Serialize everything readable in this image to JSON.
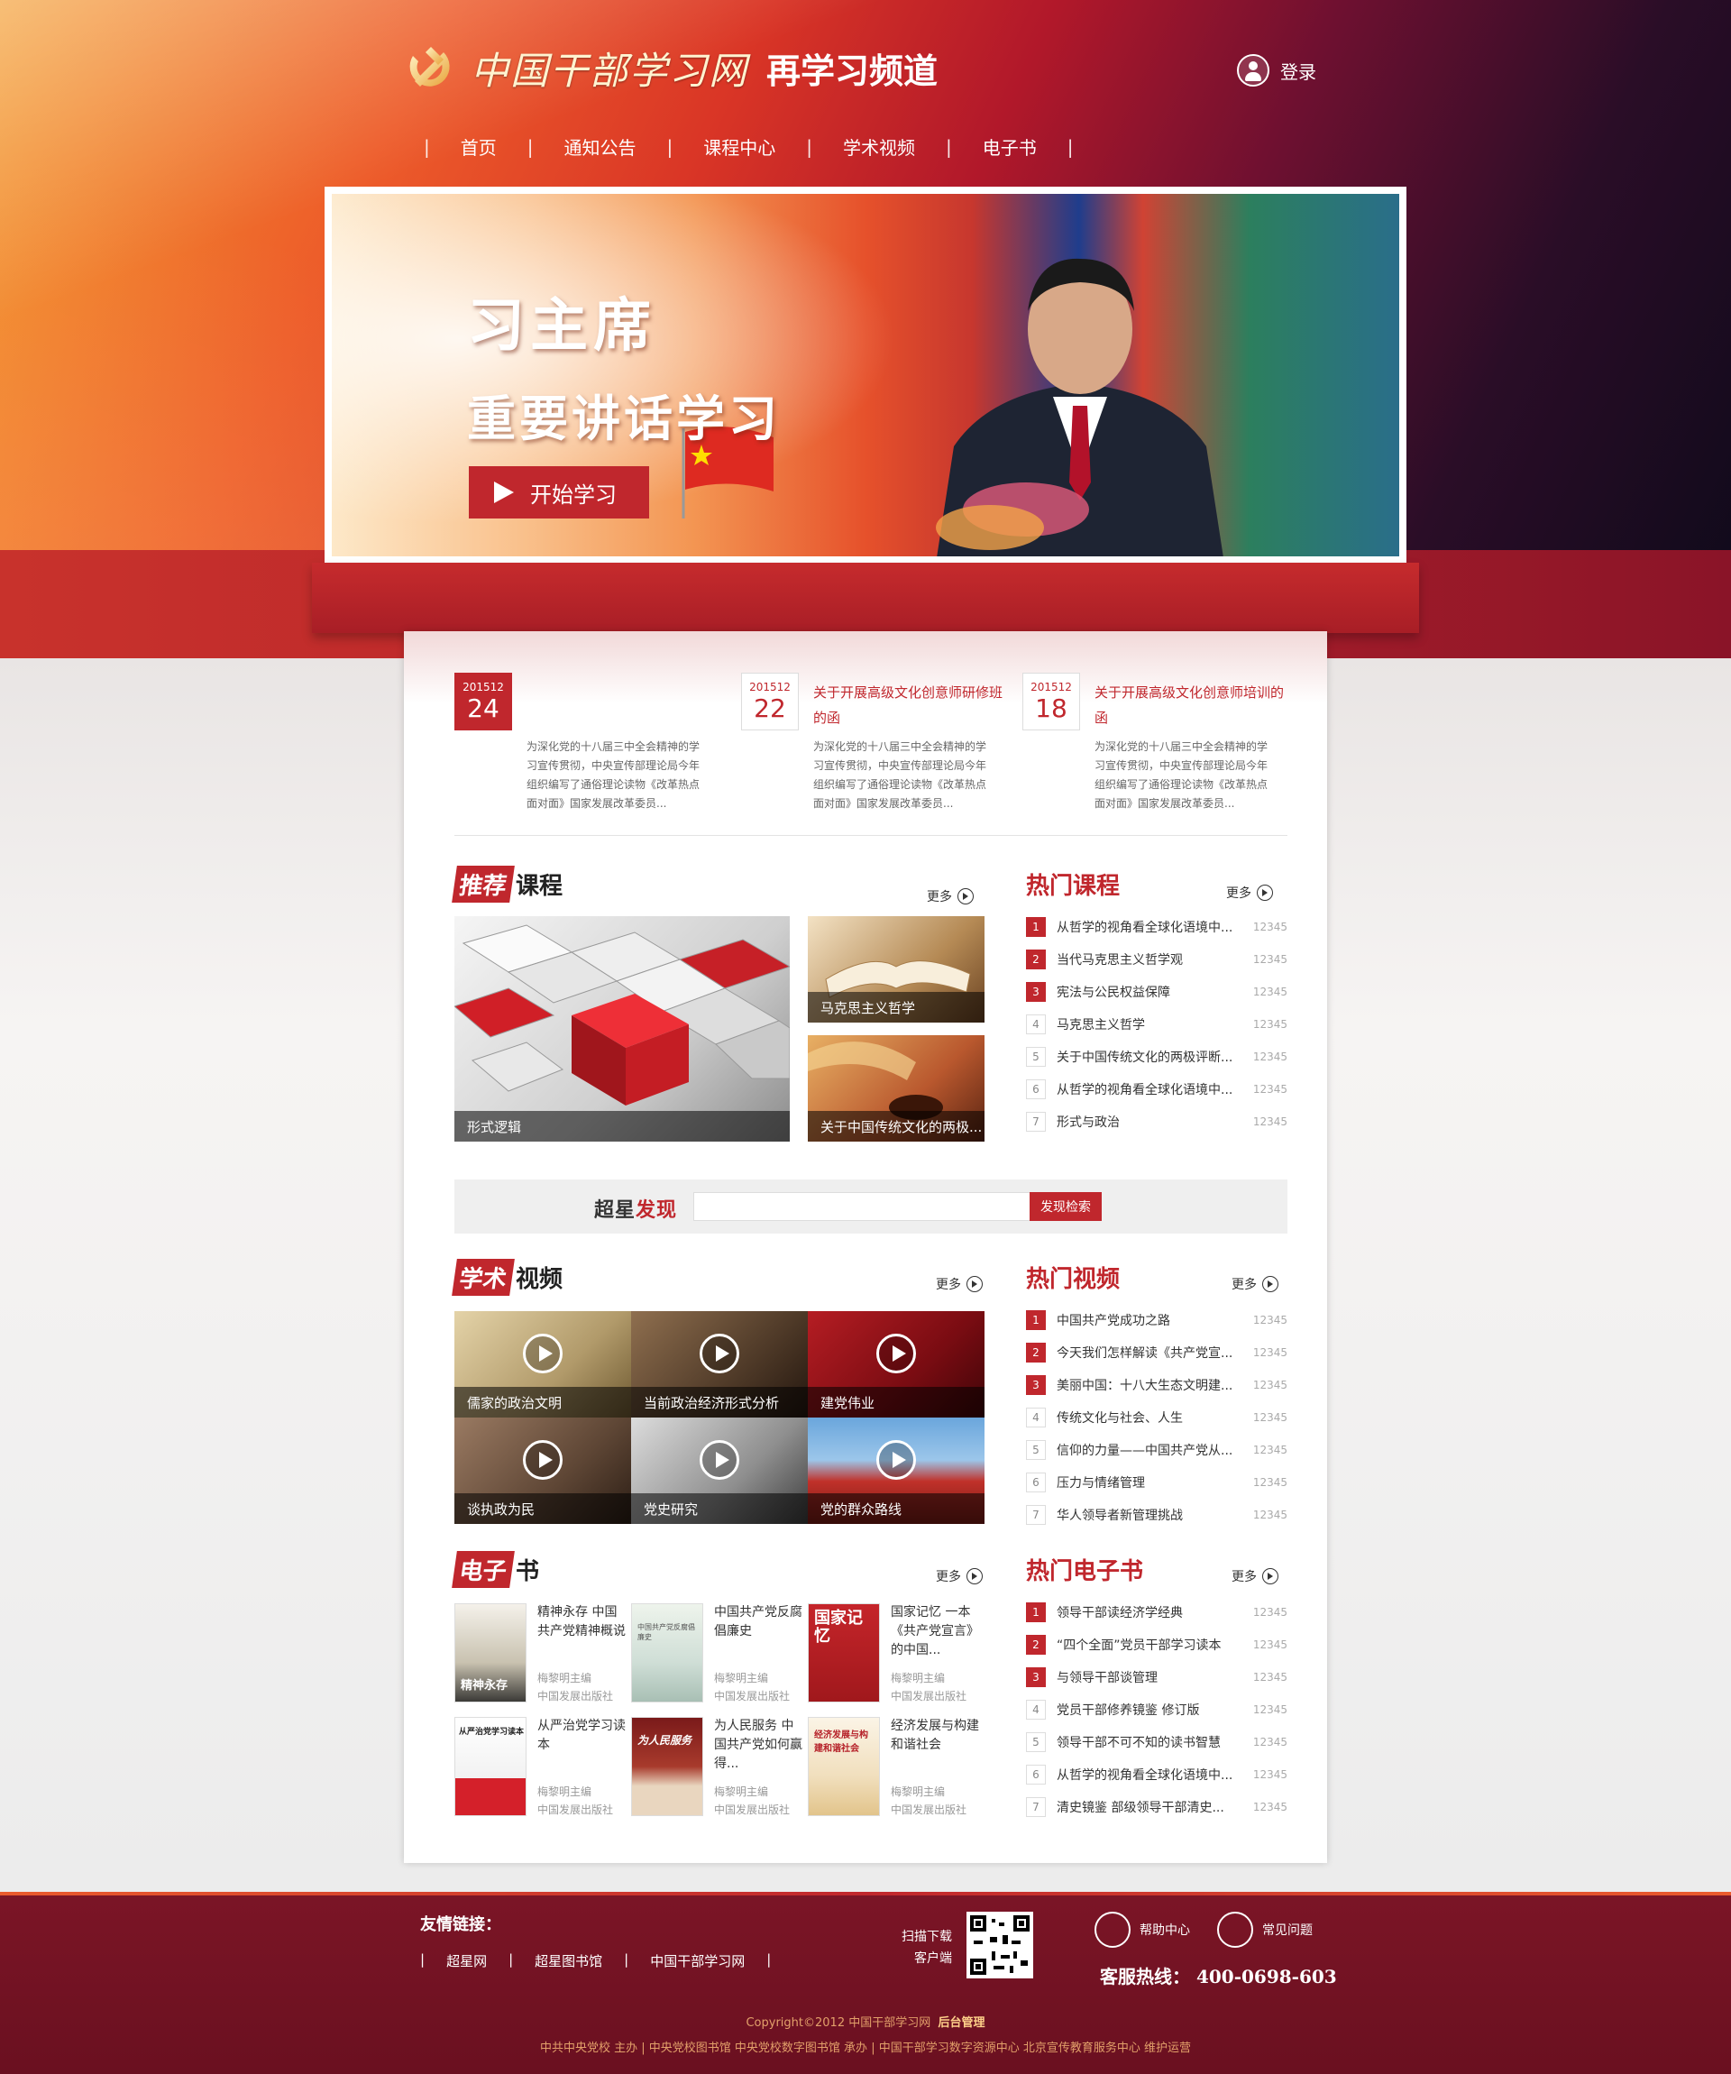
{
  "header": {
    "logo_calligraphy": "中国干部学习网",
    "logo_suffix": "再学习频道",
    "login_label": "登录"
  },
  "nav": {
    "items": [
      {
        "label": "首页"
      },
      {
        "label": "通知公告"
      },
      {
        "label": "课程中心"
      },
      {
        "label": "学术视频"
      },
      {
        "label": "电子书"
      }
    ]
  },
  "banner": {
    "title_line1": "习主席",
    "title_line2": "重要讲话学习",
    "button_label": "开始学习"
  },
  "news": [
    {
      "ym": "201512",
      "day": "24",
      "title": "",
      "desc": "为深化党的十八届三中全会精神的学习宣传贯彻，中央宣传部理论局今年组织编写了通俗理论读物《改革热点面对面》国家发展改革委员..."
    },
    {
      "ym": "201512",
      "day": "22",
      "title": "关于开展高级文化创意师研修班的函",
      "desc": "为深化党的十八届三中全会精神的学习宣传贯彻，中央宣传部理论局今年组织编写了通俗理论读物《改革热点面对面》国家发展改革委员..."
    },
    {
      "ym": "201512",
      "day": "18",
      "title": "关于开展高级文化创意师培训的函",
      "desc": "为深化党的十八届三中全会精神的学习宣传贯彻，中央宣传部理论局今年组织编写了通俗理论读物《改革热点面对面》国家发展改革委员..."
    }
  ],
  "more_label": "更多",
  "courses": {
    "title_hl": "推荐",
    "title_rest": "课程",
    "items": [
      {
        "caption": "形式逻辑"
      },
      {
        "caption": "马克思主义哲学"
      },
      {
        "caption": "关于中国传统文化的两极..."
      }
    ]
  },
  "hot_courses": {
    "title": "热门课程",
    "items": [
      {
        "num": "1",
        "text": "从哲学的视角看全球化语境中...",
        "count": "12345"
      },
      {
        "num": "2",
        "text": "当代马克思主义哲学观",
        "count": "12345"
      },
      {
        "num": "3",
        "text": "宪法与公民权益保障",
        "count": "12345"
      },
      {
        "num": "4",
        "text": "马克思主义哲学",
        "count": "12345"
      },
      {
        "num": "5",
        "text": "关于中国传统文化的两极评断...",
        "count": "12345"
      },
      {
        "num": "6",
        "text": "从哲学的视角看全球化语境中...",
        "count": "12345"
      },
      {
        "num": "7",
        "text": "形式与政治",
        "count": "12345"
      }
    ]
  },
  "search": {
    "label_a": "超星",
    "label_b": "发现",
    "placeholder": "",
    "button_label": "发现检索"
  },
  "videos": {
    "title_hl": "学术",
    "title_rest": "视频",
    "items": [
      {
        "caption": "儒家的政治文明"
      },
      {
        "caption": "当前政治经济形式分析"
      },
      {
        "caption": "建党伟业"
      },
      {
        "caption": "谈执政为民"
      },
      {
        "caption": "党史研究"
      },
      {
        "caption": "党的群众路线"
      }
    ]
  },
  "hot_videos": {
    "title": "热门视频",
    "items": [
      {
        "num": "1",
        "text": "中国共产党成功之路",
        "count": "12345"
      },
      {
        "num": "2",
        "text": "今天我们怎样解读《共产党宣...",
        "count": "12345"
      },
      {
        "num": "3",
        "text": "美丽中国：十八大生态文明建...",
        "count": "12345"
      },
      {
        "num": "4",
        "text": "传统文化与社会、人生",
        "count": "12345"
      },
      {
        "num": "5",
        "text": "信仰的力量——中国共产党从...",
        "count": "12345"
      },
      {
        "num": "6",
        "text": "压力与情绪管理",
        "count": "12345"
      },
      {
        "num": "7",
        "text": "华人领导者新管理挑战",
        "count": "12345"
      }
    ]
  },
  "ebooks": {
    "title_hl": "电子",
    "title_rest": "书",
    "items": [
      {
        "title": "精神永存 中国共产党精神概说",
        "author": "梅黎明主编",
        "publisher": "中国发展出版社",
        "cover_text": "精神永存"
      },
      {
        "title": "中国共产党反腐倡廉史",
        "author": "梅黎明主编",
        "publisher": "中国发展出版社",
        "cover_text": "中国共产党反腐倡廉史"
      },
      {
        "title": "国家记忆 一本《共产党宣言》的中国...",
        "author": "梅黎明主编",
        "publisher": "中国发展出版社",
        "cover_text": "国家记忆"
      },
      {
        "title": "从严治党学习读本",
        "author": "梅黎明主编",
        "publisher": "中国发展出版社",
        "cover_text": "从严治党学习读本"
      },
      {
        "title": "为人民服务 中国共产党如何赢得...",
        "author": "梅黎明主编",
        "publisher": "中国发展出版社",
        "cover_text": "为人民服务"
      },
      {
        "title": "经济发展与构建和谐社会",
        "author": "梅黎明主编",
        "publisher": "中国发展出版社",
        "cover_text": "经济发展与构建和谐社会"
      }
    ]
  },
  "hot_ebooks": {
    "title": "热门电子书",
    "items": [
      {
        "num": "1",
        "text": "领导干部读经济学经典",
        "count": "12345"
      },
      {
        "num": "2",
        "text": "“四个全面”党员干部学习读本",
        "count": "12345"
      },
      {
        "num": "3",
        "text": "与领导干部谈管理",
        "count": "12345"
      },
      {
        "num": "4",
        "text": "党员干部修养镜鉴 修订版",
        "count": "12345"
      },
      {
        "num": "5",
        "text": "领导干部不可不知的读书智慧",
        "count": "12345"
      },
      {
        "num": "6",
        "text": "从哲学的视角看全球化语境中...",
        "count": "12345"
      },
      {
        "num": "7",
        "text": "清史镜鉴 部级领导干部清史...",
        "count": "12345"
      }
    ]
  },
  "footer": {
    "links_title": "友情链接：",
    "links": [
      "超星网",
      "超星图书馆",
      "中国干部学习网"
    ],
    "scan_line1": "扫描下载",
    "scan_line2": "客户端",
    "help_center": "帮助中心",
    "faq": "常见问题",
    "hotline": "客服热线： 400-0698-603",
    "copyright": "Copyright©2012 中国干部学习网",
    "admin": "后台管理",
    "org": "中共中央党校 主办 | 中央党校图书馆 中央党校数字图书馆 承办 | 中国干部学习数字资源中心 北京宣传教育服务中心 维护运营"
  },
  "colors": {
    "accent": "#c0272d",
    "footer_bg": "#6e1222",
    "gold": "#e2a06a"
  }
}
